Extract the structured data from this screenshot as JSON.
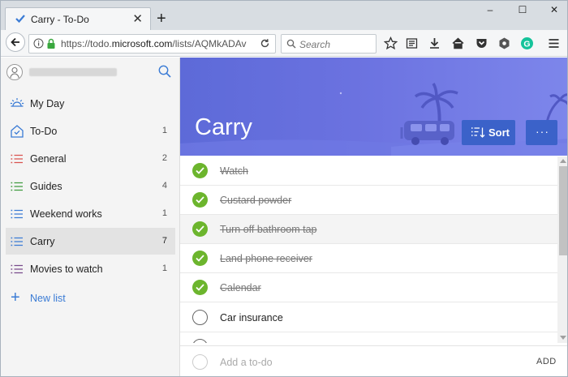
{
  "browser": {
    "tab_title": "Carry - To-Do",
    "close_glyph": "✕",
    "new_tab_glyph": "+",
    "window_controls": [
      "–",
      "☐",
      "✕"
    ],
    "url_prefix": "https://todo.",
    "url_host": "microsoft.com",
    "url_path": "/lists/AQMkADAv",
    "search_placeholder": "Search",
    "toolbar_icons": [
      "star-icon",
      "reading-list-icon",
      "download-icon",
      "home-icon",
      "pocket-icon",
      "extension-icon",
      "grammarly-icon",
      "menu-icon"
    ],
    "grammarly_letter": "G"
  },
  "sidebar": {
    "items": [
      {
        "label": "My Day",
        "count": "",
        "icon": "sun-icon"
      },
      {
        "label": "To-Do",
        "count": "1",
        "icon": "home-list-icon"
      },
      {
        "label": "General",
        "count": "2",
        "icon": "list-icon"
      },
      {
        "label": "Guides",
        "count": "4",
        "icon": "list-icon"
      },
      {
        "label": "Weekend works",
        "count": "1",
        "icon": "list-icon"
      },
      {
        "label": "Carry",
        "count": "7",
        "icon": "list-icon",
        "selected": true
      },
      {
        "label": "Movies to watch",
        "count": "1",
        "icon": "list-icon"
      }
    ],
    "new_list_label": "New list"
  },
  "main": {
    "list_title": "Carry",
    "sort_label": "Sort",
    "more_label": "···",
    "tasks": [
      {
        "label": "Watch",
        "completed": true
      },
      {
        "label": "Custard powder",
        "completed": true
      },
      {
        "label": "Turn off bathroom tap",
        "completed": true
      },
      {
        "label": "Land phone receiver",
        "completed": true
      },
      {
        "label": "Calendar",
        "completed": true
      },
      {
        "label": "Car insurance",
        "completed": false
      }
    ],
    "add_placeholder": "Add a to-do",
    "add_button": "ADD"
  },
  "colors": {
    "banner": "#6b72e0",
    "button": "#3b62c9",
    "check_green": "#6cb52d",
    "accent_blue": "#3a7bd5"
  }
}
